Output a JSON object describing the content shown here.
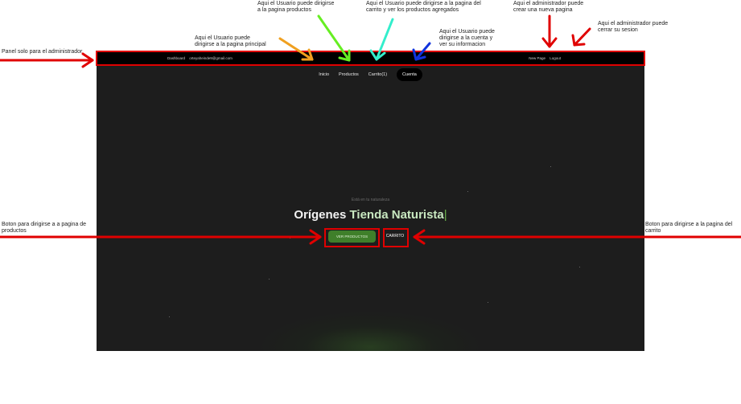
{
  "annotations": {
    "admin_panel": "Panel solo para el administrador",
    "home": [
      "Aqui el Usuario puede",
      "dirigirse a la pagina principal"
    ],
    "products": [
      "Aqui el Usuario puede dirigirse",
      "a la pagina productos"
    ],
    "cart": [
      "Aqui el Usuario puede dirigirse a la pagina del",
      "carrito y ver los productos agregados"
    ],
    "account": [
      "Aqui el Usuario puede",
      "dirigirse a la cuenta y",
      "ver su informacion"
    ],
    "new_page": [
      "Aqui el administrador puede",
      "crear una nueva pagina"
    ],
    "logout": [
      "Aqui el administrador puede",
      "cerrar su sesion"
    ],
    "products_button": [
      "Boton para dirigirse a  a pagina de",
      "productos"
    ],
    "cart_button": [
      "Boton para dirigirse a la pagina del",
      "carrito"
    ]
  },
  "admin_bar": {
    "dashboard": "Dashboard",
    "email": "orteyaheinde9@gmail.com",
    "new_page": "New Page",
    "logout": "Logout"
  },
  "nav": {
    "home": "Inicio",
    "products": "Productos",
    "cart": "Carrito",
    "cart_count": "(1)",
    "account": "Cuenta"
  },
  "hero": {
    "subtitle": "Está en tu naturaleza",
    "title_part1": "Orígenes",
    "title_part2": "Tienda Naturista",
    "products_button": "VER PRODUCTOS",
    "cart_button": "CARRITO"
  },
  "colors": {
    "background": "#1d1d1d",
    "accent_green": "#3f7f2a",
    "annotation_red": "#e00000"
  }
}
